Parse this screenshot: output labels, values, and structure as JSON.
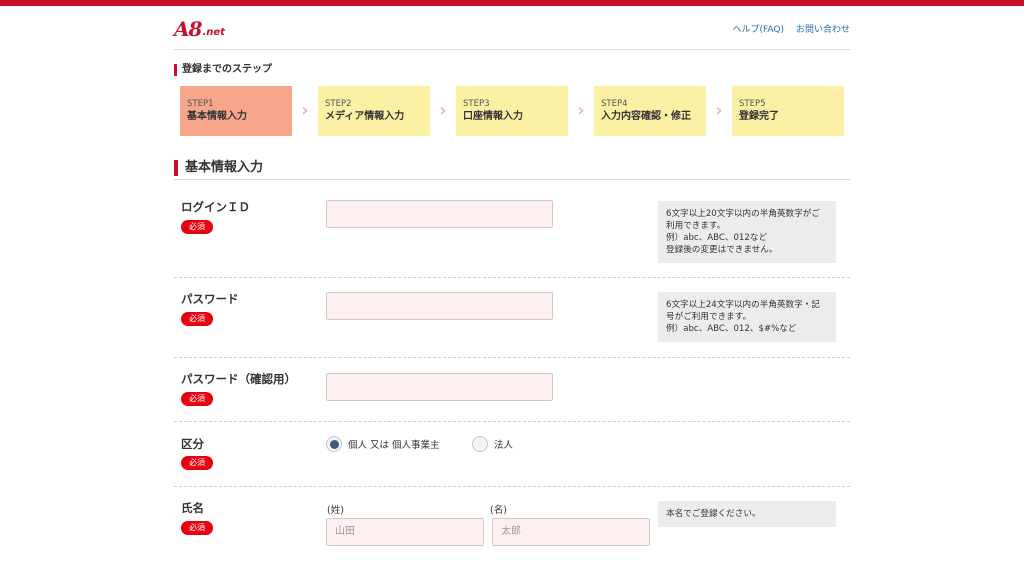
{
  "header": {
    "logo": "A8",
    "logo_suffix": ".net",
    "links": [
      "ヘルプ(FAQ)",
      "お問い合わせ"
    ]
  },
  "steps_title": "登録までのステップ",
  "steps": [
    {
      "num": "STEP1",
      "label": "基本情報入力",
      "active": true
    },
    {
      "num": "STEP2",
      "label": "メディア情報入力",
      "active": false
    },
    {
      "num": "STEP3",
      "label": "口座情報入力",
      "active": false
    },
    {
      "num": "STEP4",
      "label": "入力内容確認・修正",
      "active": false
    },
    {
      "num": "STEP5",
      "label": "登録完了",
      "active": false
    }
  ],
  "section_title": "基本情報入力",
  "required_label": "必須",
  "fields": {
    "login_id": {
      "label": "ログインＩＤ",
      "value": "",
      "hint": "6文字以上20文字以内の半角英数字がご利用できます。\n例）abc、ABC、012など\n登録後の変更はできません。"
    },
    "password": {
      "label": "パスワード",
      "value": "",
      "hint": "6文字以上24文字以内の半角英数字・記号がご利用できます。\n例）abc、ABC、012、$#%など"
    },
    "password_confirm": {
      "label": "パスワード（確認用）",
      "value": ""
    },
    "category": {
      "label": "区分",
      "options": [
        "個人 又は 個人事業主",
        "法人"
      ],
      "selected": "個人 又は 個人事業主"
    },
    "name": {
      "label": "氏名",
      "last_label": "(姓)",
      "first_label": "(名)",
      "last_placeholder": "山田",
      "first_placeholder": "太郎",
      "hint": "本名でご登録ください。"
    }
  },
  "colors": {
    "brand": "#c8102e",
    "required": "#e60012",
    "step_active": "#f7a68b",
    "step": "#fbf0a4",
    "input_bg": "#fdf0f0",
    "link": "#2a6fb0"
  }
}
